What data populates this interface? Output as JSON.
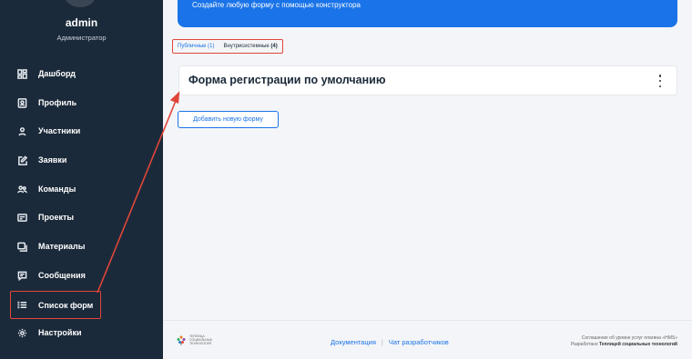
{
  "sidebar": {
    "user_name": "admin",
    "user_role": "Администратор",
    "items": [
      {
        "label": "Дашборд",
        "icon": "dashboard-icon"
      },
      {
        "label": "Профиль",
        "icon": "profile-icon"
      },
      {
        "label": "Участники",
        "icon": "user-icon"
      },
      {
        "label": "Заявки",
        "icon": "edit-icon"
      },
      {
        "label": "Команды",
        "icon": "team-icon"
      },
      {
        "label": "Проекты",
        "icon": "project-icon"
      },
      {
        "label": "Материалы",
        "icon": "materials-icon"
      },
      {
        "label": "Сообщения",
        "icon": "message-icon"
      },
      {
        "label": "Список форм",
        "icon": "list-icon",
        "active": true
      },
      {
        "label": "Настройки",
        "icon": "gear-icon"
      }
    ]
  },
  "banner": {
    "text": "Создайте любую форму с помощью конструктора"
  },
  "tabs": [
    {
      "label": "Публичные",
      "count": "(1)"
    },
    {
      "label": "Внутрисистемные",
      "count": "(4)"
    }
  ],
  "forms": [
    {
      "title": "Форма регистрации по умолчанию"
    }
  ],
  "add_form_button": "Добавить новую форму",
  "footer": {
    "logo_text_1": "ТЕПЛИЦА",
    "logo_text_2": "СОЦИАЛЬНЫХ",
    "logo_text_3": "ТЕХНОЛОГИЙ",
    "links": [
      "Документация",
      "Чат разработчиков"
    ],
    "right_line_1": "Соглашение об уровне услуг плагина «НМS»",
    "right_line_2_prefix": "Разработано",
    "right_line_2_bold": "Теплицей социальных технологий"
  },
  "colors": {
    "sidebar_bg": "#1b2a3a",
    "accent": "#1a73e8",
    "highlight": "#e0453a"
  }
}
